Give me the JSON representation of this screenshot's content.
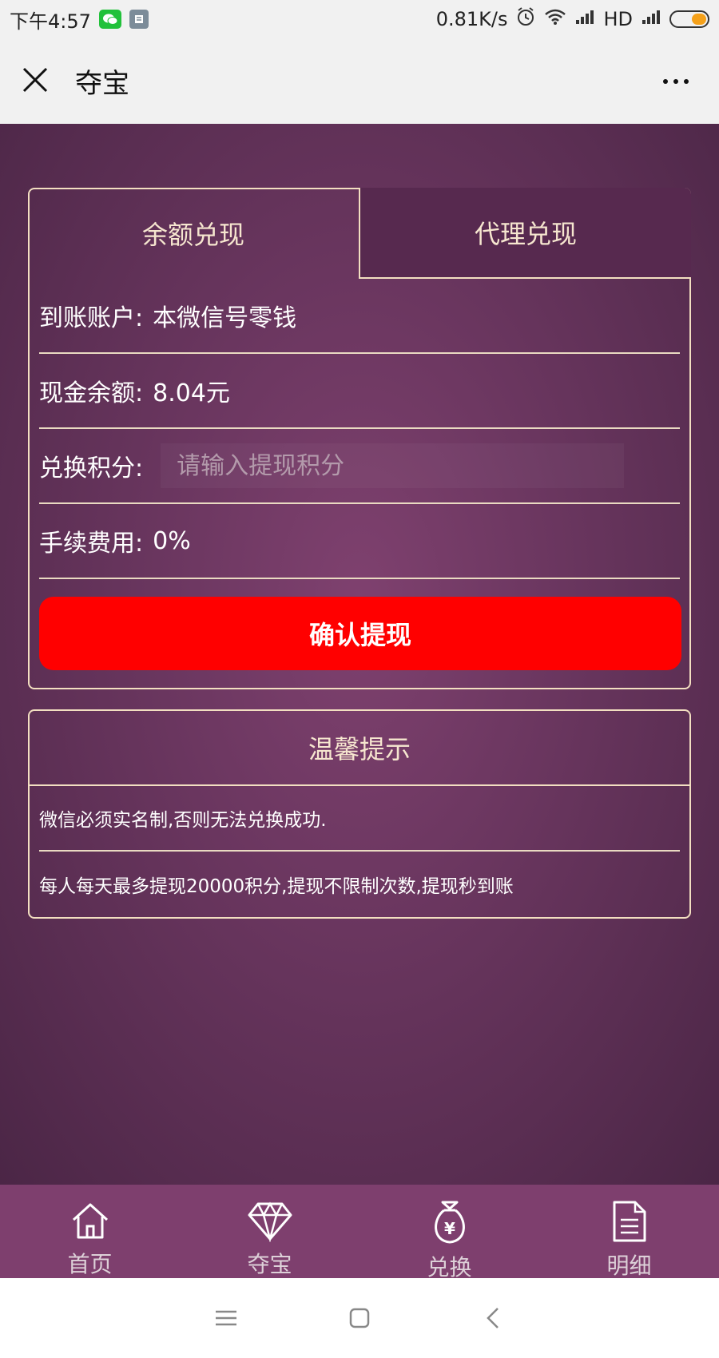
{
  "status_bar": {
    "time": "下午4:57",
    "network_speed": "0.81K/s",
    "network_type": "HD"
  },
  "title_bar": {
    "title": "夺宝"
  },
  "exchange_card": {
    "tabs": [
      {
        "label": "余额兑现",
        "active": true
      },
      {
        "label": "代理兑现",
        "active": false
      }
    ],
    "rows": {
      "account_label": "到账账户:",
      "account_value": "本微信号零钱",
      "balance_label": "现金余额:",
      "balance_value": "8.04元",
      "points_label": "兑换积分:",
      "points_placeholder": "请输入提现积分",
      "fee_label": "手续费用:",
      "fee_value": "0%"
    },
    "confirm_label": "确认提现"
  },
  "tips_card": {
    "title": "温馨提示",
    "items": [
      "微信必须实名制,否则无法兑换成功.",
      "每人每天最多提现20000积分,提现不限制次数,提现秒到账"
    ]
  },
  "bottom_nav": {
    "items": [
      {
        "label": "首页",
        "icon": "home-icon"
      },
      {
        "label": "夺宝",
        "icon": "diamond-icon"
      },
      {
        "label": "兑换",
        "icon": "money-bag-icon"
      },
      {
        "label": "明细",
        "icon": "document-icon"
      }
    ]
  },
  "colors": {
    "background": "#6a365f",
    "accent_border": "#f3dfc1",
    "confirm_button": "#ff0000",
    "bottom_nav": "#7e3f6e"
  }
}
